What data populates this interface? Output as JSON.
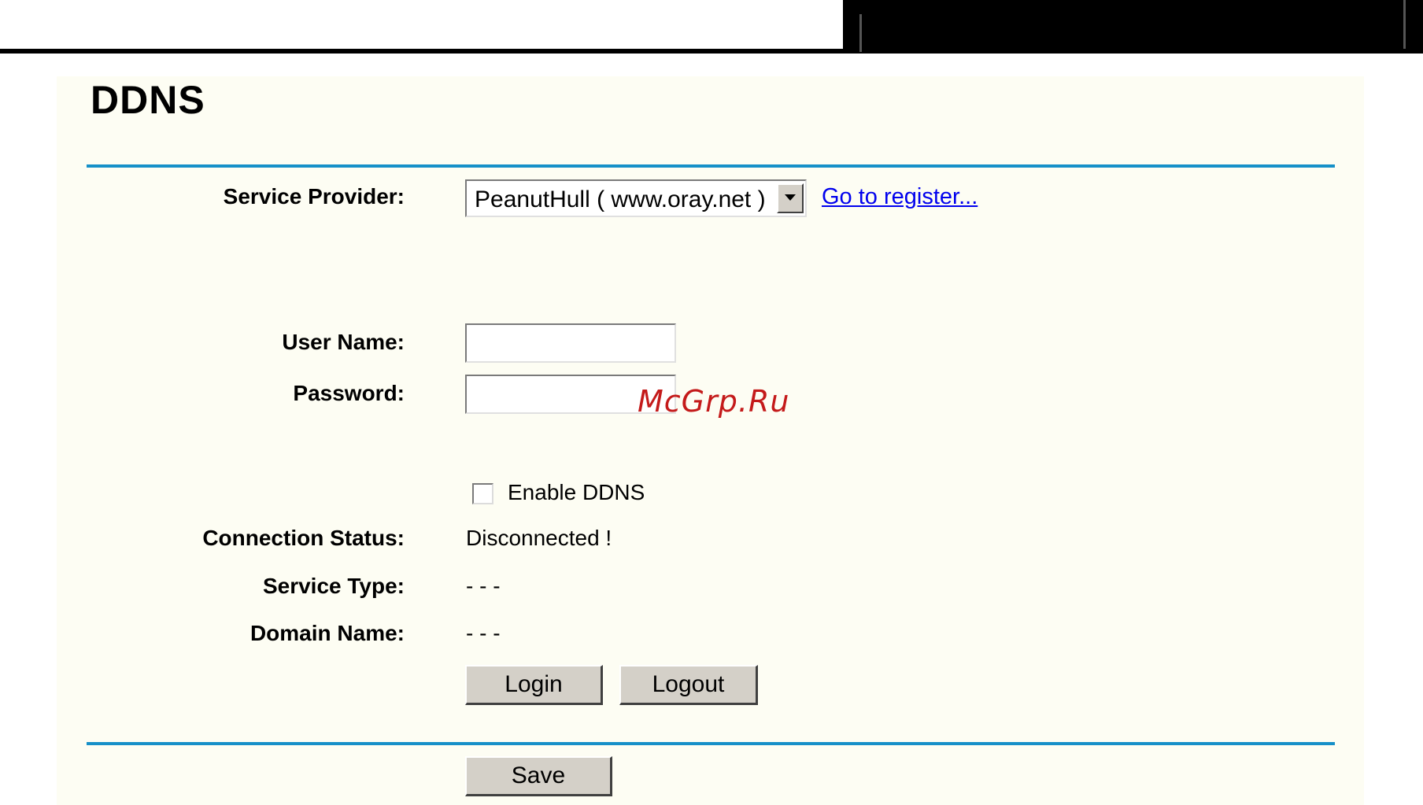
{
  "page": {
    "title": "DDNS"
  },
  "form": {
    "service_provider": {
      "label": "Service Provider:",
      "selected": "PeanutHull ( www.oray.net )",
      "register_link": "Go to register..."
    },
    "user_name": {
      "label": "User Name:",
      "value": ""
    },
    "password": {
      "label": "Password:",
      "value": ""
    },
    "enable_ddns": {
      "label": "Enable DDNS",
      "checked": false
    },
    "connection_status": {
      "label": "Connection Status:",
      "value": "Disconnected !"
    },
    "service_type": {
      "label": "Service Type:",
      "value": "- - -"
    },
    "domain_name": {
      "label": "Domain Name:",
      "value": "- - -"
    }
  },
  "buttons": {
    "login": "Login",
    "logout": "Logout",
    "save": "Save"
  },
  "watermark": "McGrp.Ru",
  "colors": {
    "panel_bg": "#fdfdf3",
    "rule": "#1690c8",
    "link": "#0000ee",
    "watermark": "#c41a1a"
  }
}
